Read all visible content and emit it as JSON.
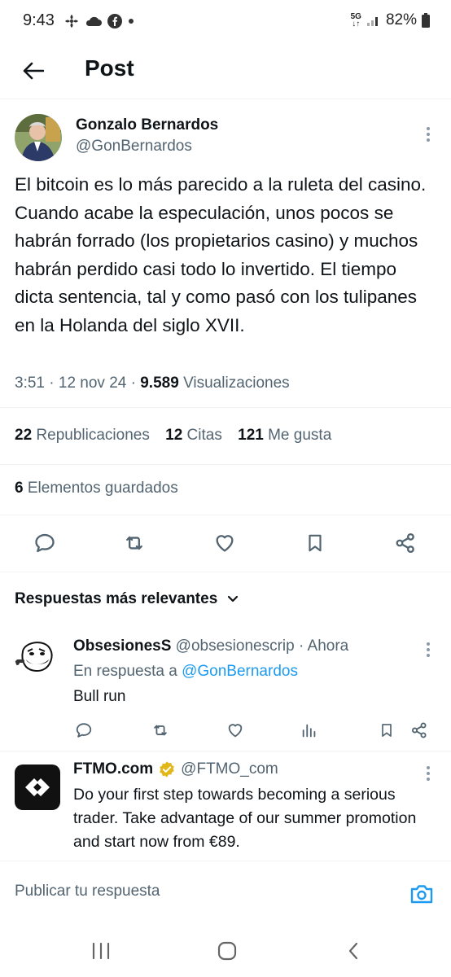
{
  "status_bar": {
    "time": "9:43",
    "network": "5G",
    "battery": "82%"
  },
  "header": {
    "title": "Post"
  },
  "post": {
    "author_name": "Gonzalo Bernardos",
    "author_handle": "@GonBernardos",
    "text": "El bitcoin es lo más parecido a la ruleta del casino. Cuando acabe la especulación, unos pocos se habrán forrado (los propietarios casino) y muchos habrán perdido casi todo lo invertido. El tiempo dicta sentencia, tal y como pasó con los tulipanes en la Holanda del siglo XVII.",
    "time": "3:51",
    "date": "12 nov 24",
    "views_count": "9.589",
    "views_label": "Visualizaciones",
    "reposts_count": "22",
    "reposts_label": "Republicaciones",
    "quotes_count": "12",
    "quotes_label": "Citas",
    "likes_count": "121",
    "likes_label": "Me gusta",
    "bookmarks_count": "6",
    "bookmarks_label": "Elementos guardados"
  },
  "replies_section": {
    "title": "Respuestas más relevantes"
  },
  "reply": {
    "author_name": "ObsesionesS",
    "author_handle": "@obsesionescrip",
    "separator": "·",
    "time": "Ahora",
    "in_reply_prefix": "En respuesta a",
    "in_reply_handle": "@GonBernardos",
    "text": "Bull run"
  },
  "ad": {
    "author_name": "FTMO.com",
    "author_handle": "@FTMO_com",
    "text": "Do your first step towards becoming a serious trader. Take advantage of our summer promotion and start now from €89."
  },
  "compose": {
    "placeholder": "Publicar tu respuesta"
  },
  "colors": {
    "accent": "#1d9bf0",
    "text_primary": "#0f1419",
    "text_secondary": "#536471",
    "verified_gold": "#e2b719"
  }
}
